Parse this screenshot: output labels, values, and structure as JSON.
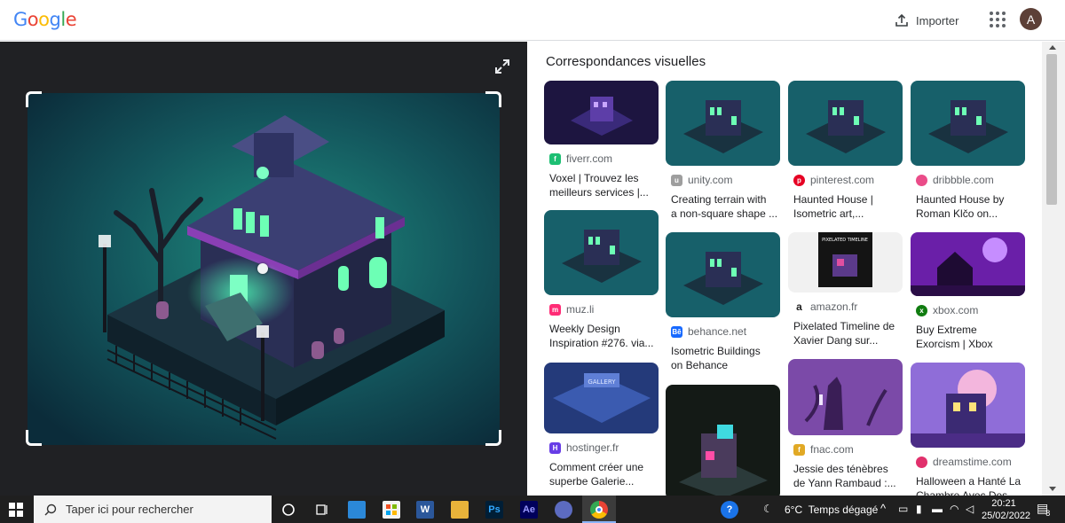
{
  "header": {
    "logo_letters": [
      "G",
      "o",
      "o",
      "g",
      "l",
      "e"
    ],
    "logo_colors": [
      "#4285F4",
      "#EA4335",
      "#FBBC05",
      "#4285F4",
      "#34A853",
      "#EA4335"
    ],
    "import_label": "Importer",
    "avatar_letter": "A",
    "apps_icon": "apps-grid-icon"
  },
  "visual_matches": {
    "title": "Correspondances visuelles",
    "results": [
      {
        "site": "fiverr.com",
        "title_line1": "Voxel | Trouvez les",
        "title_line2": "meilleurs services |...",
        "favicon": "fiverr-icon",
        "favicon_color": "#1dbf73"
      },
      {
        "site": "unity.com",
        "title_line1": "Creating terrain with",
        "title_line2": "a non-square shape ...",
        "favicon": "unity-icon",
        "favicon_color": "#9e9e9e"
      },
      {
        "site": "pinterest.com",
        "title_line1": "Haunted House |",
        "title_line2": "Isometric art,...",
        "favicon": "pinterest-icon",
        "favicon_color": "#e60023"
      },
      {
        "site": "dribbble.com",
        "title_line1": "Haunted House by",
        "title_line2": "Roman Klčo on...",
        "favicon": "dribbble-icon",
        "favicon_color": "#ea4c89"
      },
      {
        "site": "muz.li",
        "title_line1": "Weekly Design",
        "title_line2": "Inspiration #276. via...",
        "favicon": "muzli-icon",
        "favicon_color": "#ff2c76"
      },
      {
        "site": "behance.net",
        "title_line1": "Isometric Buildings",
        "title_line2": "on Behance",
        "favicon": "behance-icon",
        "favicon_color": "#1769ff"
      },
      {
        "site": "amazon.fr",
        "title_line1": "Pixelated Timeline de",
        "title_line2": "Xavier Dang sur...",
        "favicon": "amazon-icon",
        "favicon_color": "#222222"
      },
      {
        "site": "xbox.com",
        "title_line1": "Buy Extreme",
        "title_line2": "Exorcism | Xbox",
        "favicon": "xbox-icon",
        "favicon_color": "#107c10"
      },
      {
        "site": "hostinger.fr",
        "title_line1": "Comment créer une",
        "title_line2": "superbe Galerie...",
        "favicon": "hostinger-icon",
        "favicon_color": "#673de6"
      },
      {
        "site": "",
        "title_line1": "",
        "title_line2": "",
        "favicon": "",
        "favicon_color": "#000000"
      },
      {
        "site": "fnac.com",
        "title_line1": "Jessie des ténèbres",
        "title_line2": "de Yann Rambaud :...",
        "favicon": "fnac-icon",
        "favicon_color": "#e1a925"
      },
      {
        "site": "dreamstime.com",
        "title_line1": "Halloween a Hanté La",
        "title_line2": "Chambre Avec Des...",
        "favicon": "dreamstime-icon",
        "favicon_color": "#e1306c"
      }
    ],
    "amazon_thumb_text": "PIXELATED TIMELINE",
    "hostinger_thumb_text": "GALLERY"
  },
  "taskbar": {
    "search_placeholder": "Taper ici pour rechercher",
    "weather_temp": "6°C",
    "weather_text": "Temps dégagé",
    "time": "20:21",
    "date": "25/02/2022",
    "notification_count": "8",
    "word_label": "W",
    "photoshop_label": "Ps",
    "aftereffects_label": "Ae"
  }
}
